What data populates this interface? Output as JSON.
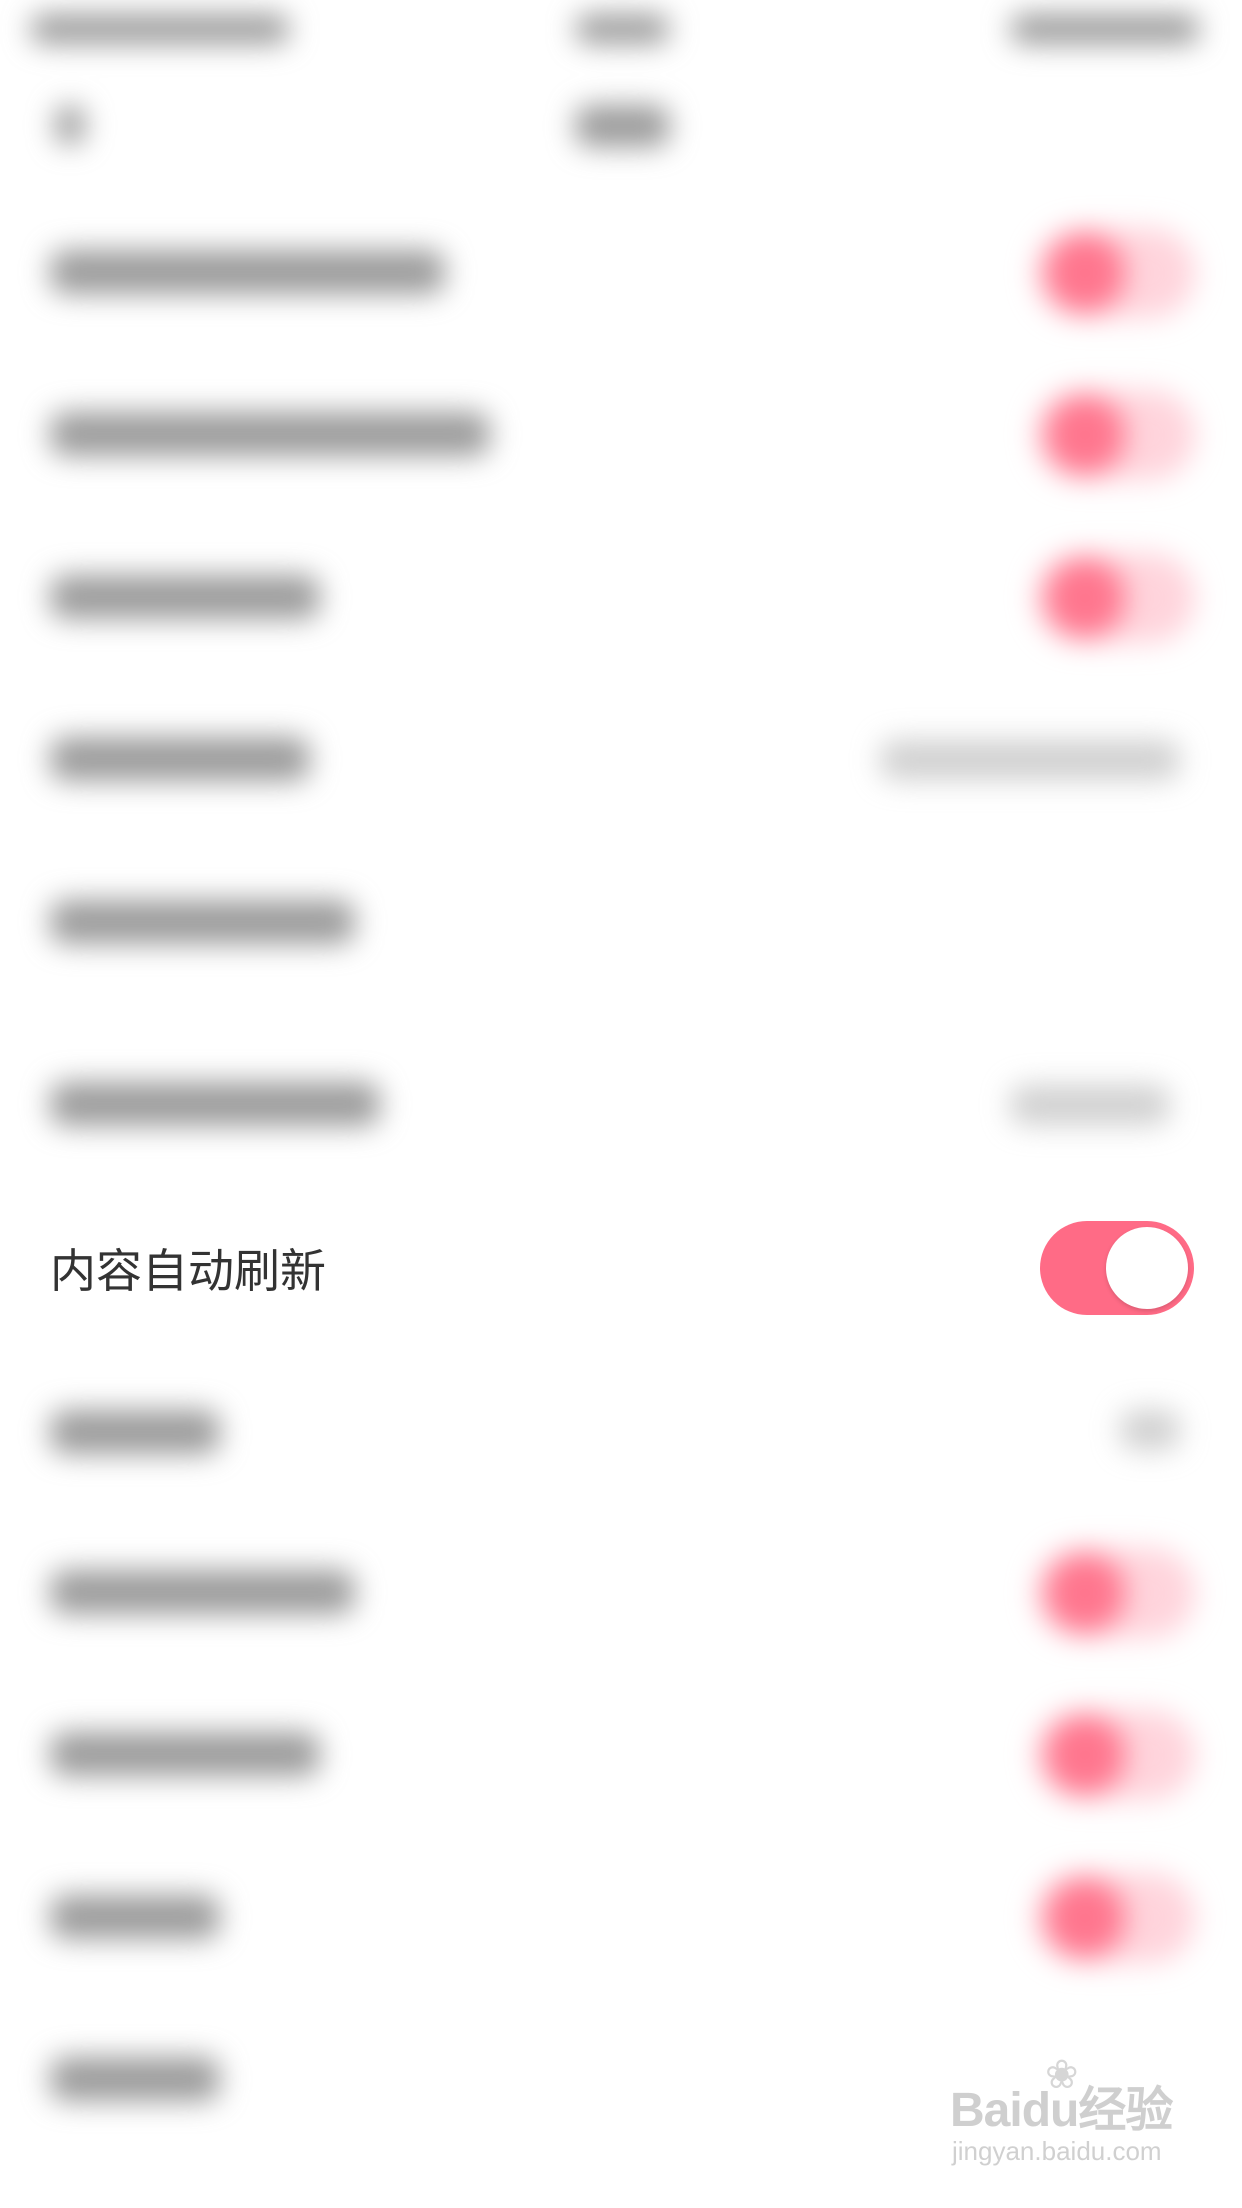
{
  "settings": {
    "focused_item": {
      "label": "内容自动刷新",
      "toggle_on": true
    }
  },
  "watermark": {
    "logo": "Baidu经验",
    "url": "jingyan.baidu.com"
  },
  "colors": {
    "accent": "#ff6b86",
    "text": "#333333",
    "background": "#ffffff"
  }
}
